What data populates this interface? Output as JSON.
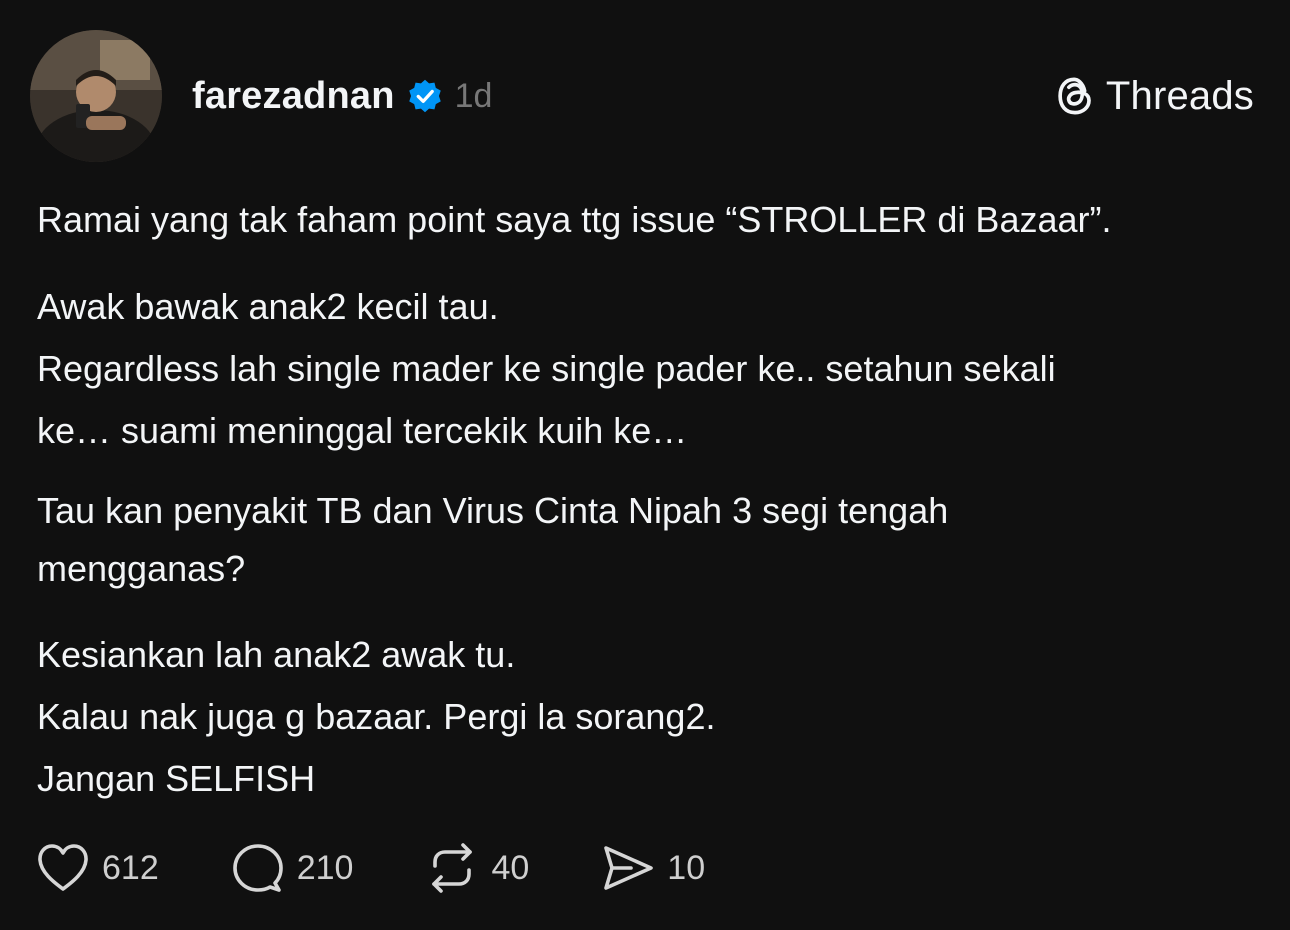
{
  "post": {
    "author": {
      "username": "farezadnan",
      "verified": true,
      "timestamp": "1d"
    },
    "brand": {
      "label": "Threads",
      "icon": "threads-logo-icon"
    },
    "body": {
      "paragraphs": [
        [
          "Ramai yang tak faham point saya ttg issue “STROLLER di Bazaar”."
        ],
        [
          "Awak bawak anak2 kecil tau.",
          "Regardless lah single mader ke single pader ke.. setahun sekali",
          "ke… suami meninggal tercekik kuih ke…"
        ],
        [
          "Tau kan penyakit TB dan Virus Cinta Nipah 3 segi tengah",
          "mengganas?"
        ],
        [
          "Kesiankan lah anak2 awak tu.",
          "Kalau nak juga g bazaar. Pergi la sorang2.",
          "Jangan SELFISH"
        ]
      ]
    },
    "actions": {
      "likes": "612",
      "replies": "210",
      "reposts": "40",
      "shares": "10"
    }
  },
  "colors": {
    "background": "#101010",
    "text": "#f3f5f7",
    "muted": "#777777",
    "verified_badge": "#0095f6"
  }
}
